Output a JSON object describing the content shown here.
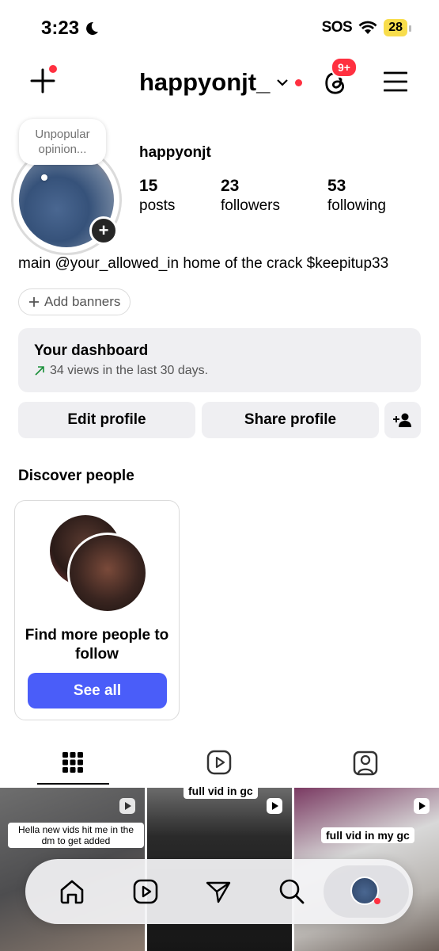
{
  "status_bar": {
    "time": "3:23",
    "carrier": "SOS",
    "battery": "28"
  },
  "header": {
    "username": "happyonjt_",
    "notifications_badge": "9+"
  },
  "profile": {
    "note": "Unpopular opinion...",
    "display_name": "happyonjt",
    "stats": [
      {
        "value": "15",
        "label": "posts"
      },
      {
        "value": "23",
        "label": "followers"
      },
      {
        "value": "53",
        "label": "following"
      }
    ],
    "bio": "main @your_allowed_in home of the crack $keepitup33",
    "add_banners": "Add banners"
  },
  "dashboard": {
    "title": "Your dashboard",
    "subtitle": "34 views in the last 30 days."
  },
  "buttons": {
    "edit": "Edit profile",
    "share": "Share profile"
  },
  "discover": {
    "title": "Discover people",
    "card_text": "Find more people to follow",
    "see_all": "See all"
  },
  "grid": {
    "captions": [
      "Hella new vids hit me in the dm to get added",
      "full vid in gc",
      "full vid in my gc"
    ]
  },
  "colors": {
    "accent": "#4a5df9",
    "notification": "#ff3040",
    "surface": "#efeff2"
  },
  "icons": {
    "tabs": [
      "grid-icon",
      "reels-icon",
      "tagged-icon"
    ],
    "nav": [
      "home-icon",
      "reels-icon",
      "send-icon",
      "search-icon",
      "profile-avatar"
    ]
  }
}
